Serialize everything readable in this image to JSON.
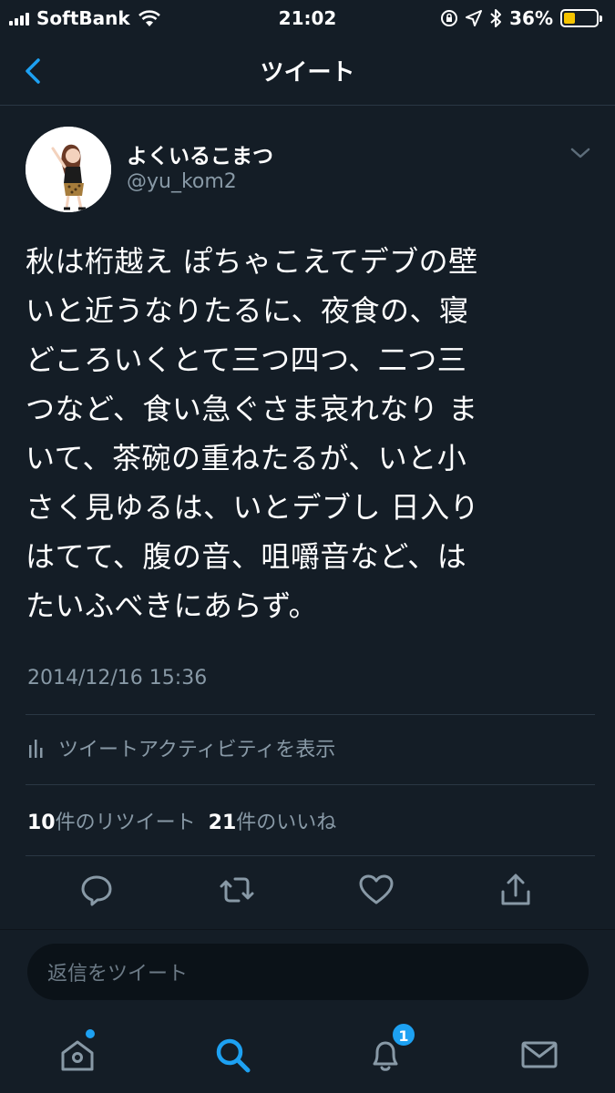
{
  "status_bar": {
    "carrier": "SoftBank",
    "time": "21:02",
    "battery_percent": "36%",
    "battery_level": 0.36
  },
  "nav": {
    "title": "ツイート"
  },
  "tweet": {
    "display_name": "よくいるこまつ",
    "handle": "@yu_kom2",
    "text": "秋は桁越え ぽちゃこえてデブの壁\nいと近うなりたるに、夜食の、寝\nどころいくとて三つ四つ、二つ三\nつなど、食い急ぐさま哀れなり ま\nいて、茶碗の重ねたるが、いと小\nさく見ゆるは、いとデブし 日入り\nはてて、腹の音、咀嚼音など、は\nたいふべきにあらず。",
    "timestamp": "2014/12/16 15:36",
    "activity_label": "ツイートアクティビティを表示",
    "retweet_count": "10",
    "retweet_label": "件のリツイート",
    "like_count": "21",
    "like_label": "件のいいね"
  },
  "reply": {
    "placeholder": "返信をツイート"
  },
  "tab_bar": {
    "notification_badge": "1"
  },
  "colors": {
    "background": "#141d26",
    "text_secondary": "#8899a6",
    "accent": "#1da1f2",
    "divider": "#2a3744"
  }
}
